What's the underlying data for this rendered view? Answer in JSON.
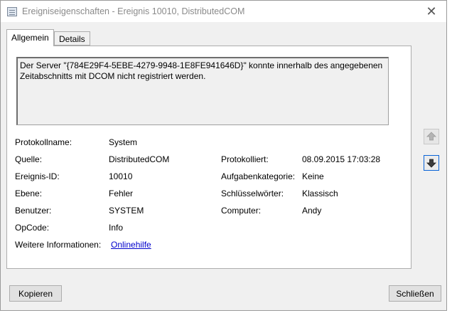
{
  "window": {
    "title": "Ereigniseigenschaften - Ereignis 10010, DistributedCOM",
    "close_glyph": "✕"
  },
  "tabs": [
    {
      "label": "Allgemein"
    },
    {
      "label": "Details"
    }
  ],
  "description": "Der Server \"{784E29F4-5EBE-4279-9948-1E8FE941646D}\" konnte innerhalb des angegebenen Zeitabschnitts mit DCOM nicht registriert werden.",
  "fields": {
    "protokollname": {
      "label": "Protokollname:",
      "value": "System"
    },
    "quelle": {
      "label": "Quelle:",
      "value": "DistributedCOM"
    },
    "ereignis_id": {
      "label": "Ereignis-ID:",
      "value": "10010"
    },
    "ebene": {
      "label": "Ebene:",
      "value": "Fehler"
    },
    "benutzer": {
      "label": "Benutzer:",
      "value": "SYSTEM"
    },
    "opcode": {
      "label": "OpCode:",
      "value": "Info"
    },
    "weitere": {
      "label": "Weitere Informationen:",
      "link": "Onlinehilfe"
    },
    "protokolliert": {
      "label": "Protokolliert:",
      "value": "08.09.2015 17:03:28"
    },
    "aufgabenkategorie": {
      "label": "Aufgabenkategorie:",
      "value": "Keine"
    },
    "schluesselwoerter": {
      "label": "Schlüsselwörter:",
      "value": "Klassisch"
    },
    "computer": {
      "label": "Computer:",
      "value": "Andy"
    }
  },
  "buttons": {
    "copy": "Kopieren",
    "close": "Schließen"
  },
  "icons": {
    "up": "arrow-up-icon",
    "down": "arrow-down-icon"
  },
  "colors": {
    "link": "#0000cc",
    "focus_border": "#0a64d8"
  }
}
